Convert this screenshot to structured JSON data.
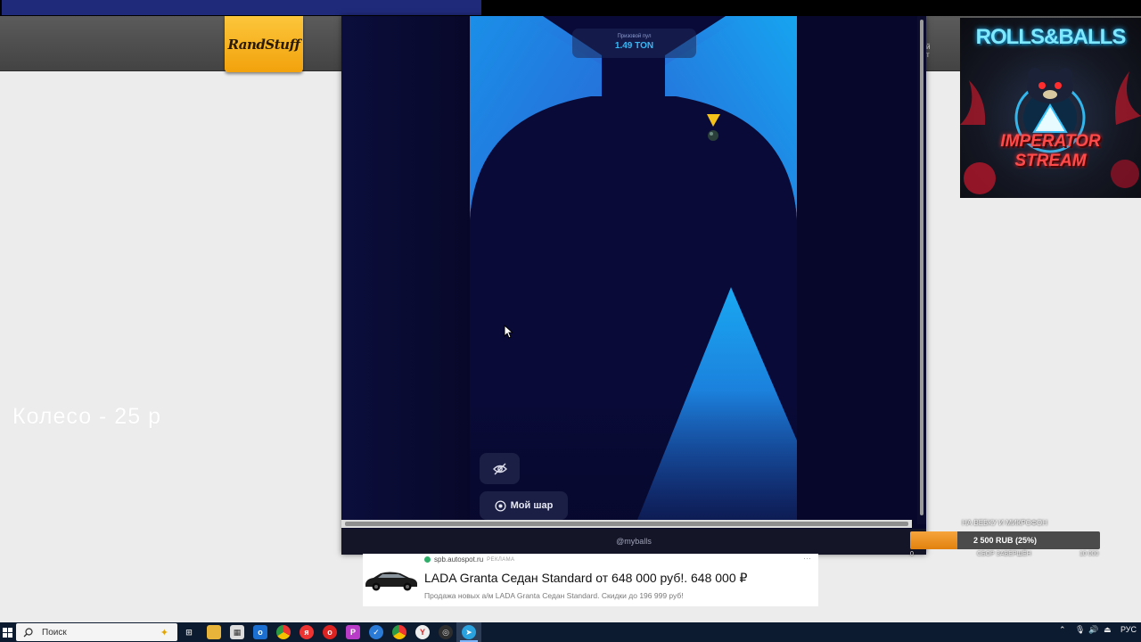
{
  "site": {
    "logo_text": "RandStuff",
    "wheel_label": "Колесо - 25 р",
    "side_text": "й\nт"
  },
  "overlay_art": {
    "title": "ROLLS&BALLS",
    "subtitle_line1": "IMPERATOR",
    "subtitle_line2": "STREAM",
    "accent_color": "#ff3a3a",
    "glow_color": "#35c6ff"
  },
  "game": {
    "prize_caption": "Призовой пул",
    "prize_value": "1.49 TON",
    "hide_button_icon": "eye-off-icon",
    "my_ball_label": "Мой шар",
    "my_ball_icon": "eye-icon",
    "bot_handle": "@myballs",
    "colors": {
      "background": "#07082a",
      "walls": "#1a8fe8",
      "marker": "#f5c21a"
    }
  },
  "donation": {
    "title": "НА ВЕБКУ И МИКРОФОН",
    "amount_label": "2 500 RUB (25%)",
    "progress": 0.25,
    "min_label": "0",
    "status_label": "СБОР ЗАВЕРШЁН",
    "max_label": "10 000"
  },
  "ad": {
    "domain": "spb.autospot.ru",
    "tag": "РЕКЛАМА",
    "title": "LADA Granta Седан Standard от 648 000 руб!. 648 000 ₽",
    "description": "Продажа новых а/м LADA Granta Седан Standard. Скидки до 196 999 руб!",
    "more": "···"
  },
  "taskbar": {
    "search_placeholder": "Поиск",
    "language": "РУС",
    "pinned": [
      "task-view-icon",
      "file-explorer-icon",
      "store-icon",
      "outlook-icon",
      "chrome-icon",
      "yandex-icon",
      "opera-icon",
      "pycharm-icon",
      "check-icon",
      "chrome-alt-icon",
      "yandex-browser-icon",
      "obs-icon",
      "telegram-icon"
    ]
  }
}
